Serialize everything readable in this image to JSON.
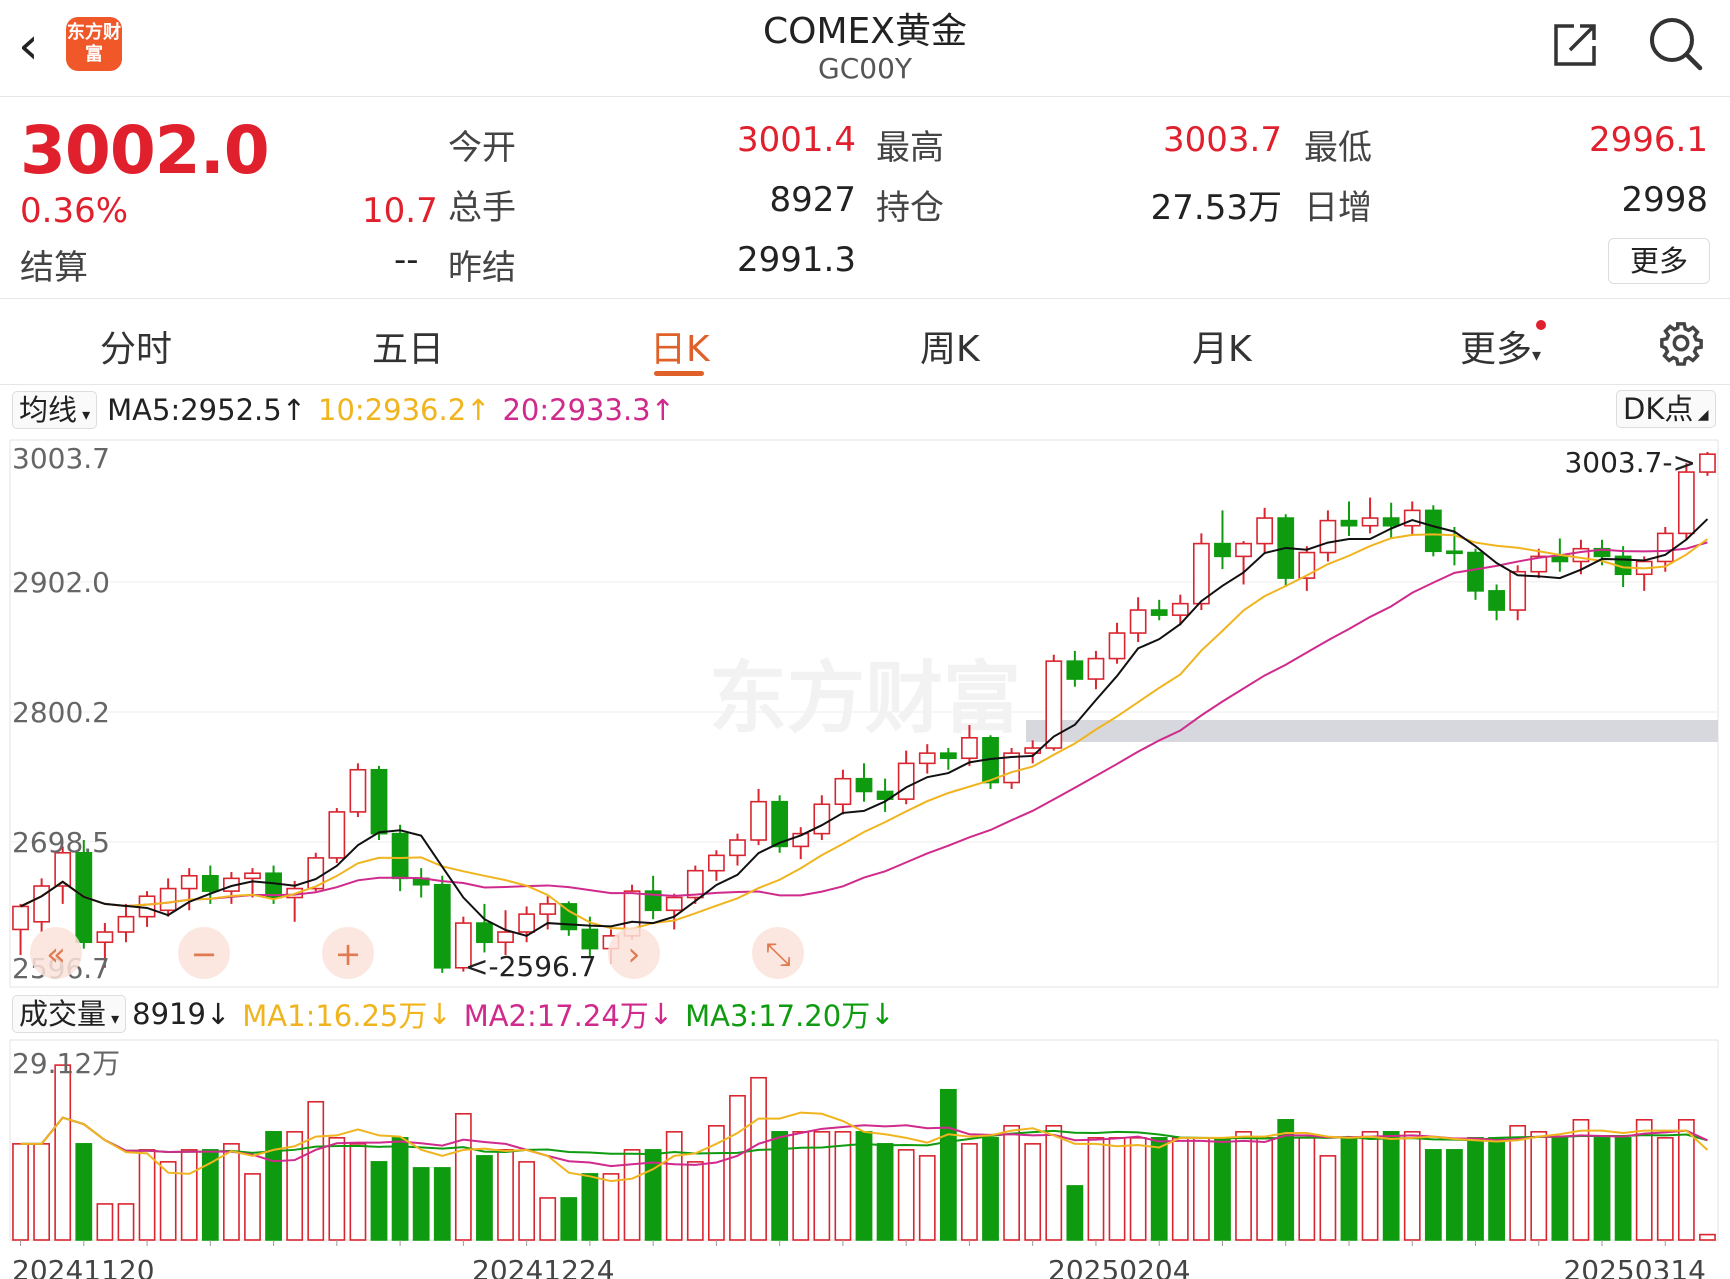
{
  "header": {
    "title": "COMEX黄金",
    "code": "GC00Y",
    "logo_text": "东方财富"
  },
  "quote": {
    "price": "3002.0",
    "change_pct": "0.36%",
    "change": "10.7",
    "settle_label": "结算",
    "settle_value": "--",
    "open_label": "今开",
    "open_value": "3001.4",
    "high_label": "最高",
    "high_value": "3003.7",
    "low_label": "最低",
    "low_value": "2996.1",
    "vol_label": "总手",
    "vol_value": "8927",
    "oi_label": "持仓",
    "oi_value": "27.53万",
    "daily_inc_label": "日增",
    "daily_inc_value": "2998",
    "prev_settle_label": "昨结",
    "prev_settle_value": "2991.3",
    "more_label": "更多"
  },
  "tabs": [
    "分时",
    "五日",
    "日K",
    "周K",
    "月K",
    "更多"
  ],
  "active_tab": "日K",
  "colors": {
    "up": "#d9252f",
    "down": "#0f9b0f",
    "ma5": "#111111",
    "ma10": "#f0b41e",
    "ma20": "#cf2a8c",
    "accent": "#e0602a"
  },
  "ma_bar": {
    "selector": "均线",
    "ma5": "MA5:2952.5",
    "ma10": "10:2936.2",
    "ma20": "20:2933.3",
    "dk": "DK点"
  },
  "vol_bar": {
    "selector": "成交量",
    "vol": "8919",
    "ma1": "MA1:16.25万",
    "ma2": "MA2:17.24万",
    "ma3": "MA3:17.20万"
  },
  "price_axis": {
    "labels": [
      "3003.7",
      "2902.0",
      "2800.2",
      "2698.5",
      "2596.7"
    ]
  },
  "annotations": {
    "high": "3003.7->",
    "low": "<-2596.7"
  },
  "volume_axis": {
    "top_label": "29.12万"
  },
  "x_axis": [
    "20241120",
    "20241224",
    "20250204",
    "20250314"
  ],
  "watermark": "东方财富",
  "chart_data": {
    "type": "candlestick",
    "title": "",
    "xlabel": "",
    "ylabel": "",
    "ylim": [
      2596.7,
      3003.7
    ],
    "volume_max_wan": 29.12,
    "grid": true,
    "x_ticks": [
      "20241120",
      "20241224",
      "20250204",
      "20250314"
    ],
    "series": [
      {
        "name": "MA5",
        "values": []
      },
      {
        "name": "10",
        "values": []
      },
      {
        "name": "20",
        "values": []
      }
    ],
    "ohlc": [
      [
        2630,
        2650,
        2610,
        2648
      ],
      [
        2636,
        2670,
        2628,
        2664
      ],
      [
        2664,
        2695,
        2650,
        2690
      ],
      [
        2690,
        2700,
        2615,
        2620
      ],
      [
        2620,
        2635,
        2600,
        2628
      ],
      [
        2628,
        2650,
        2620,
        2640
      ],
      [
        2640,
        2660,
        2632,
        2656
      ],
      [
        2645,
        2670,
        2640,
        2662
      ],
      [
        2662,
        2678,
        2645,
        2672
      ],
      [
        2672,
        2680,
        2650,
        2660
      ],
      [
        2660,
        2675,
        2650,
        2670
      ],
      [
        2670,
        2678,
        2655,
        2674
      ],
      [
        2674,
        2680,
        2650,
        2655
      ],
      [
        2655,
        2668,
        2636,
        2662
      ],
      [
        2662,
        2690,
        2660,
        2686
      ],
      [
        2686,
        2725,
        2682,
        2722
      ],
      [
        2722,
        2760,
        2718,
        2755
      ],
      [
        2755,
        2758,
        2700,
        2705
      ],
      [
        2705,
        2712,
        2660,
        2670
      ],
      [
        2670,
        2678,
        2655,
        2665
      ],
      [
        2665,
        2672,
        2596,
        2600
      ],
      [
        2600,
        2640,
        2597,
        2635
      ],
      [
        2635,
        2650,
        2612,
        2620
      ],
      [
        2620,
        2645,
        2610,
        2628
      ],
      [
        2628,
        2648,
        2620,
        2642
      ],
      [
        2642,
        2656,
        2630,
        2650
      ],
      [
        2650,
        2652,
        2625,
        2630
      ],
      [
        2630,
        2640,
        2608,
        2615
      ],
      [
        2615,
        2630,
        2603,
        2625
      ],
      [
        2625,
        2665,
        2622,
        2660
      ],
      [
        2660,
        2672,
        2638,
        2645
      ],
      [
        2645,
        2658,
        2630,
        2655
      ],
      [
        2655,
        2680,
        2650,
        2676
      ],
      [
        2676,
        2692,
        2668,
        2688
      ],
      [
        2688,
        2705,
        2680,
        2700
      ],
      [
        2700,
        2740,
        2696,
        2730
      ],
      [
        2730,
        2735,
        2690,
        2695
      ],
      [
        2695,
        2710,
        2685,
        2705
      ],
      [
        2705,
        2735,
        2700,
        2728
      ],
      [
        2728,
        2755,
        2720,
        2748
      ],
      [
        2748,
        2760,
        2730,
        2738
      ],
      [
        2738,
        2748,
        2722,
        2732
      ],
      [
        2732,
        2770,
        2728,
        2760
      ],
      [
        2760,
        2775,
        2752,
        2768
      ],
      [
        2768,
        2772,
        2755,
        2764
      ],
      [
        2764,
        2790,
        2758,
        2780
      ],
      [
        2780,
        2782,
        2740,
        2745
      ],
      [
        2745,
        2772,
        2740,
        2768
      ],
      [
        2768,
        2778,
        2760,
        2772
      ],
      [
        2772,
        2845,
        2770,
        2840
      ],
      [
        2840,
        2848,
        2820,
        2826
      ],
      [
        2826,
        2848,
        2818,
        2842
      ],
      [
        2842,
        2870,
        2838,
        2862
      ],
      [
        2862,
        2890,
        2855,
        2880
      ],
      [
        2880,
        2888,
        2872,
        2876
      ],
      [
        2876,
        2892,
        2868,
        2885
      ],
      [
        2885,
        2940,
        2880,
        2932
      ],
      [
        2932,
        2958,
        2912,
        2922
      ],
      [
        2922,
        2934,
        2900,
        2932
      ],
      [
        2932,
        2960,
        2925,
        2952
      ],
      [
        2952,
        2955,
        2898,
        2905
      ],
      [
        2905,
        2930,
        2895,
        2925
      ],
      [
        2925,
        2958,
        2918,
        2950
      ],
      [
        2950,
        2965,
        2938,
        2946
      ],
      [
        2946,
        2968,
        2940,
        2952
      ],
      [
        2952,
        2964,
        2936,
        2946
      ],
      [
        2946,
        2965,
        2938,
        2958
      ],
      [
        2958,
        2962,
        2922,
        2926
      ],
      [
        2926,
        2945,
        2915,
        2925
      ],
      [
        2925,
        2928,
        2888,
        2895
      ],
      [
        2895,
        2900,
        2872,
        2880
      ],
      [
        2880,
        2915,
        2872,
        2910
      ],
      [
        2910,
        2928,
        2905,
        2922
      ],
      [
        2922,
        2936,
        2910,
        2918
      ],
      [
        2918,
        2935,
        2908,
        2928
      ],
      [
        2928,
        2935,
        2915,
        2922
      ],
      [
        2922,
        2930,
        2898,
        2908
      ],
      [
        2908,
        2922,
        2895,
        2918
      ],
      [
        2918,
        2945,
        2910,
        2940
      ],
      [
        2940,
        2995,
        2935,
        2988
      ],
      [
        2988,
        3003.7,
        2985,
        3002
      ]
    ],
    "volume_wan": [
      16,
      16,
      29.1,
      16,
      6,
      6,
      15,
      13,
      15,
      15,
      16,
      11,
      18,
      18,
      23,
      17,
      16,
      13,
      17,
      12,
      12,
      21,
      14,
      15,
      13,
      7,
      7,
      11,
      11,
      15,
      15,
      18,
      13,
      19,
      24,
      27,
      18,
      18,
      18,
      18,
      18,
      16,
      15,
      14,
      25,
      16,
      17,
      19,
      16,
      19,
      9,
      17,
      17,
      17,
      17,
      17,
      17,
      17,
      18,
      17,
      20,
      17,
      14,
      17,
      18,
      18,
      18,
      15,
      15,
      17,
      17,
      19,
      18,
      17,
      20,
      17,
      17,
      20,
      17,
      20,
      0.9
    ]
  }
}
